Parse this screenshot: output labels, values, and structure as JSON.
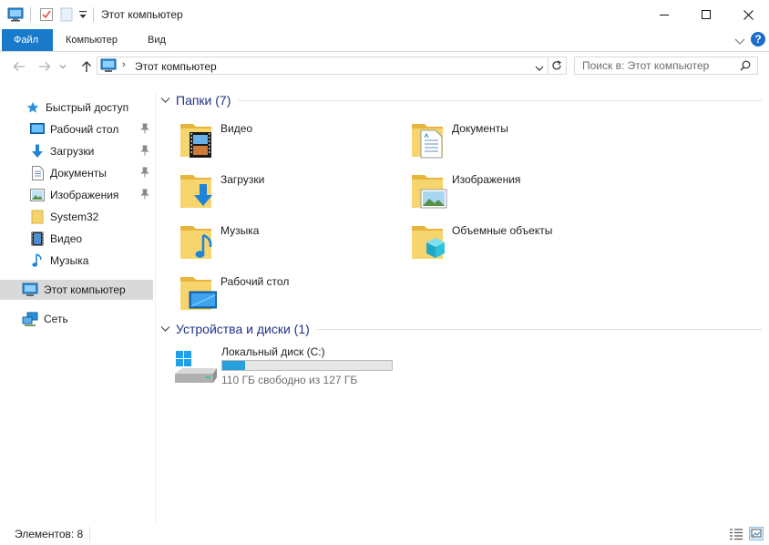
{
  "window": {
    "title": "Этот компьютер"
  },
  "ribbon": {
    "tabs": [
      {
        "label": "Файл"
      },
      {
        "label": "Компьютер"
      },
      {
        "label": "Вид"
      }
    ]
  },
  "address": {
    "path": "Этот компьютер",
    "search_placeholder": "Поиск в: Этот компьютер"
  },
  "nav": {
    "quick_access": "Быстрый доступ",
    "items": [
      {
        "label": "Рабочий стол",
        "pinned": true
      },
      {
        "label": "Загрузки",
        "pinned": true
      },
      {
        "label": "Документы",
        "pinned": true
      },
      {
        "label": "Изображения",
        "pinned": true
      },
      {
        "label": "System32",
        "pinned": false
      },
      {
        "label": "Видео",
        "pinned": false
      },
      {
        "label": "Музыка",
        "pinned": false
      }
    ],
    "this_pc": "Этот компьютер",
    "network": "Сеть"
  },
  "content": {
    "folders_header": "Папки (7)",
    "folders": [
      {
        "label": "Видео"
      },
      {
        "label": "Документы"
      },
      {
        "label": "Загрузки"
      },
      {
        "label": "Изображения"
      },
      {
        "label": "Музыка"
      },
      {
        "label": "Объемные объекты"
      },
      {
        "label": "Рабочий стол"
      }
    ],
    "devices_header": "Устройства и диски (1)",
    "drive": {
      "label": "Локальный диск (C:)",
      "free_text": "110 ГБ свободно из 127 ГБ",
      "used_fraction": 0.134
    }
  },
  "status": {
    "items_text": "Элементов: 8"
  },
  "colors": {
    "accent": "#1979ca",
    "header_text": "#1e3287",
    "folder": "#f0c94f",
    "drive_bar": "#26a0da"
  }
}
